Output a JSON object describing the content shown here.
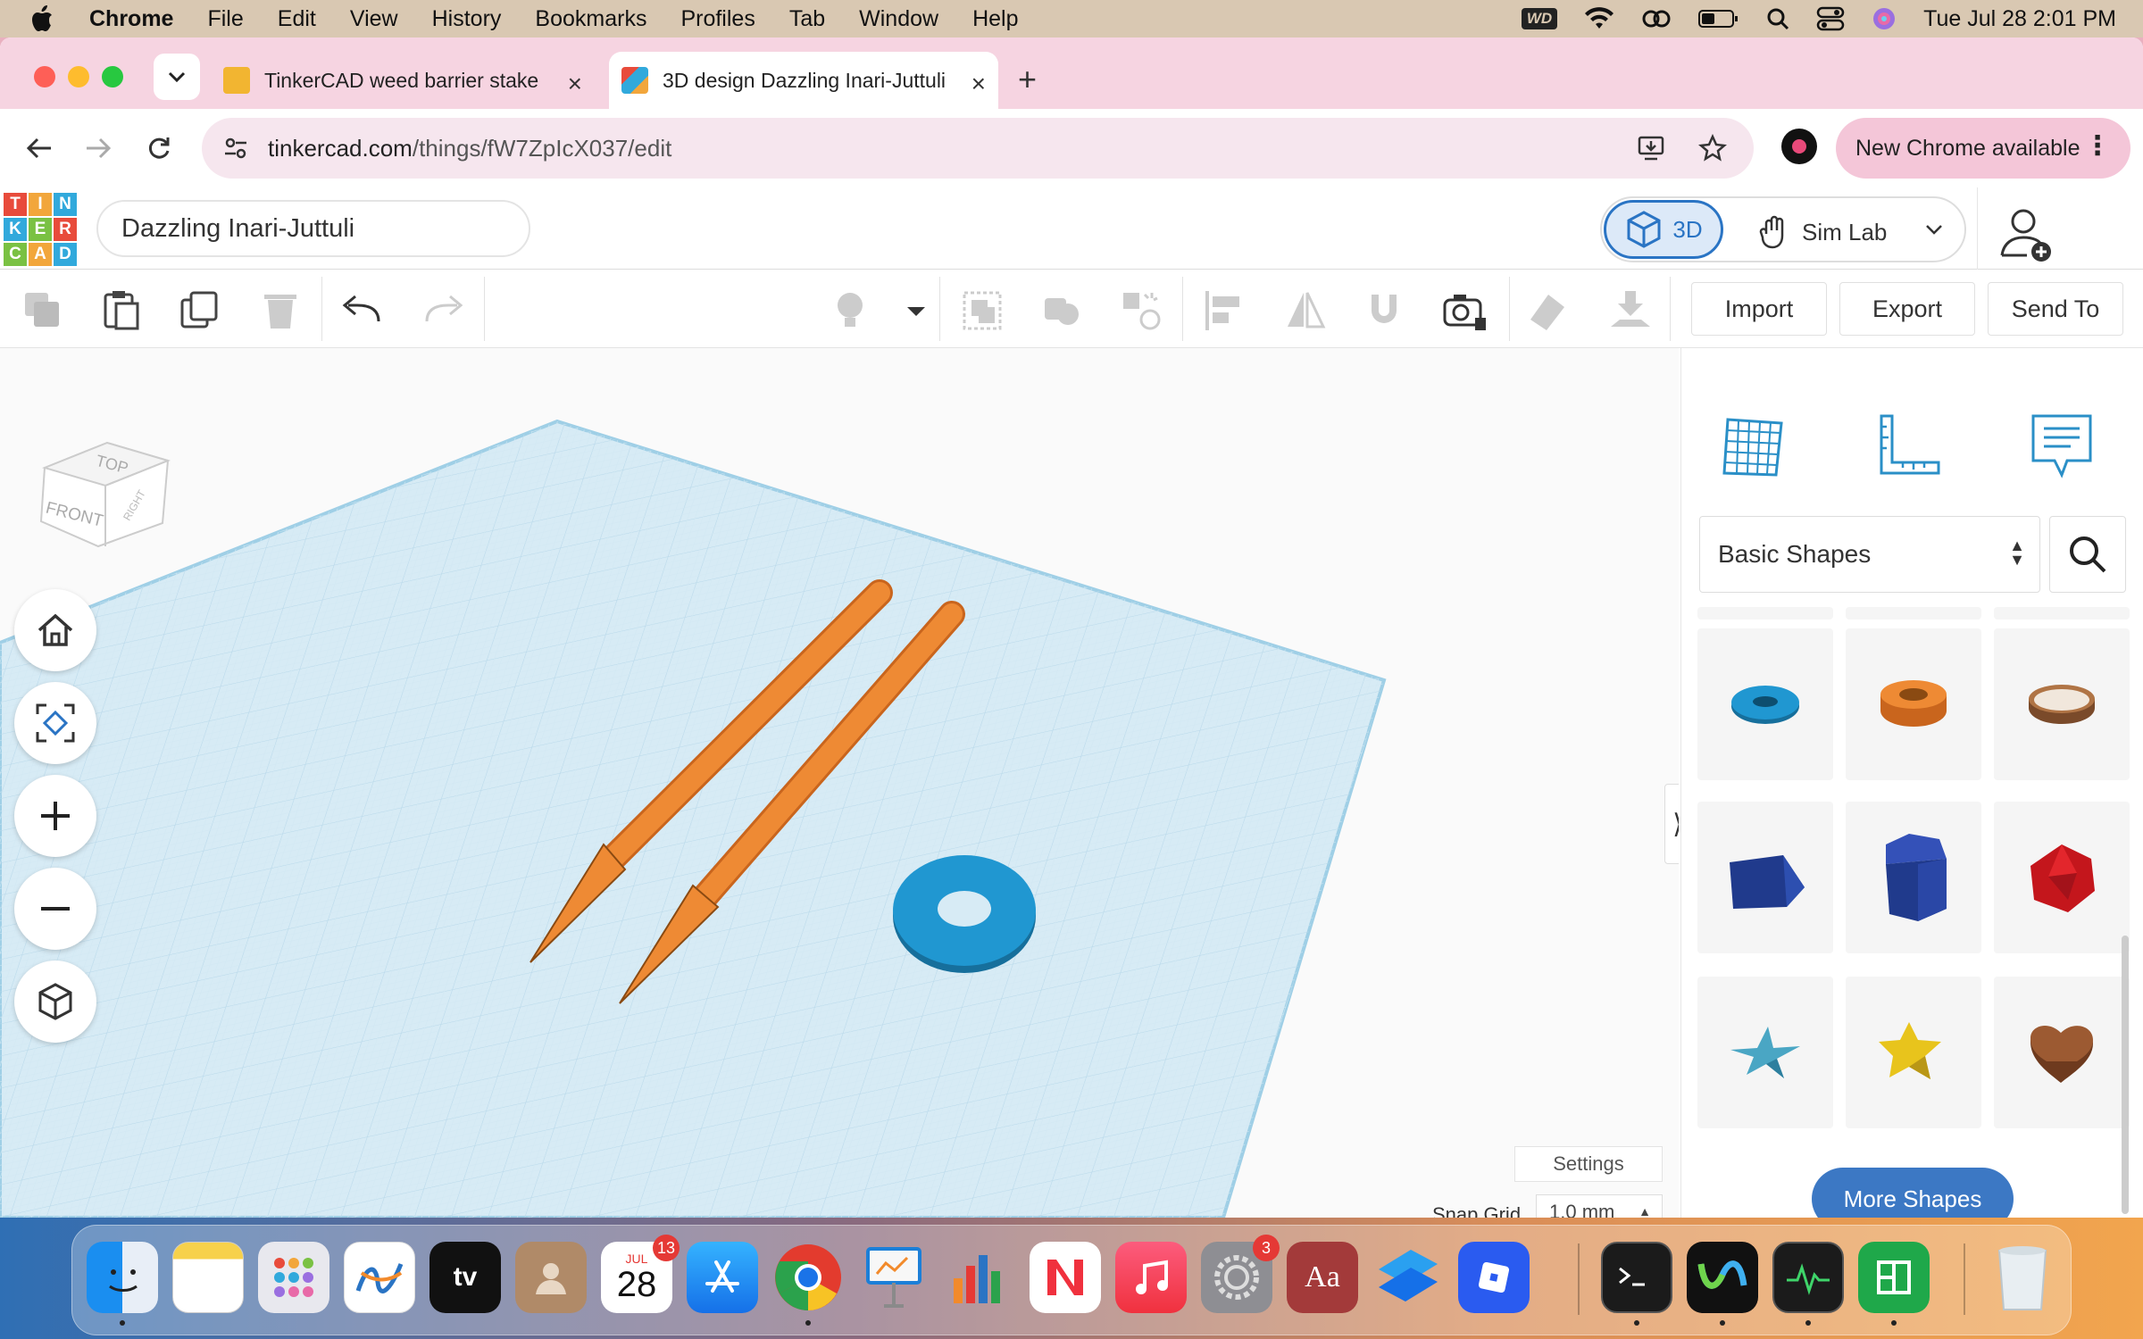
{
  "menubar": {
    "app": "Chrome",
    "items": [
      "File",
      "Edit",
      "View",
      "History",
      "Bookmarks",
      "Profiles",
      "Tab",
      "Window",
      "Help"
    ],
    "wd_label": "WD",
    "datetime": "Tue Jul 28  2:01 PM"
  },
  "tabs": [
    {
      "title": "TinkerCAD weed barrier stake",
      "active": false
    },
    {
      "title": "3D design Dazzling Inari-Juttuli",
      "active": true
    }
  ],
  "address": {
    "host": "tinkercad.com",
    "path": "/things/fW7ZpIcX037/edit",
    "update_label": "New Chrome available"
  },
  "tinkercad": {
    "logo_letters": [
      "T",
      "I",
      "N",
      "K",
      "E",
      "R",
      "C",
      "A",
      "D"
    ],
    "design_name": "Dazzling Inari-Juttuli",
    "mode_3d": "3D",
    "mode_sim": "Sim Lab",
    "import_label": "Import",
    "export_label": "Export",
    "sendto_label": "Send To",
    "viewcube_top": "TOP",
    "viewcube_front": "FRONT",
    "viewcube_right": "RIGHT",
    "settings_label": "Settings",
    "snap_grid_label": "Snap Grid",
    "snap_grid_value": "1.0 mm",
    "shape_category": "Basic Shapes",
    "more_shapes_label": "More Shapes",
    "shapes": [
      "torus-blue",
      "tube-orange",
      "ring-brown",
      "wedge-blue",
      "pentagon-prism-blue",
      "icosahedron-red",
      "star-teal",
      "star-yellow",
      "heart-brown"
    ]
  },
  "dock": {
    "calendar_month": "JUL",
    "calendar_day": "28",
    "calendar_badge": "13",
    "settings_badge": "3",
    "dictionary_label": "Aa",
    "tv_label": "tv"
  },
  "colors": {
    "accent_blue": "#3c78c4",
    "workplane": "#cfe6f3",
    "stake_orange": "#e9842f",
    "torus_blue": "#1e8fc7"
  }
}
